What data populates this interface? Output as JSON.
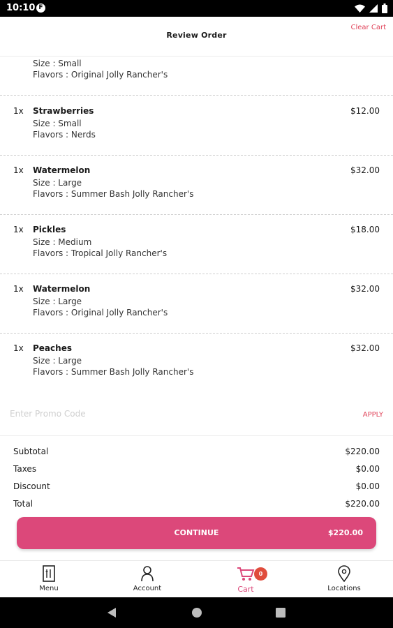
{
  "status_bar": {
    "time": "10:10",
    "app_icon": "F"
  },
  "header": {
    "title": "Review Order",
    "clear_cart_label": "Clear Cart"
  },
  "first_item_partial": {
    "size": "Size : Small",
    "flavors": "Flavors : Original Jolly Rancher's"
  },
  "items": [
    {
      "qty": "1x",
      "name": "Strawberries",
      "price": "$12.00",
      "size": "Size : Small",
      "flavors": "Flavors : Nerds"
    },
    {
      "qty": "1x",
      "name": "Watermelon",
      "price": "$32.00",
      "size": "Size : Large",
      "flavors": "Flavors : Summer Bash Jolly Rancher's"
    },
    {
      "qty": "1x",
      "name": "Pickles",
      "price": "$18.00",
      "size": "Size : Medium",
      "flavors": "Flavors : Tropical Jolly Rancher's"
    },
    {
      "qty": "1x",
      "name": "Watermelon",
      "price": "$32.00",
      "size": "Size : Large",
      "flavors": "Flavors : Original Jolly Rancher's"
    },
    {
      "qty": "1x",
      "name": "Peaches",
      "price": "$32.00",
      "size": "Size : Large",
      "flavors": "Flavors : Summer Bash Jolly Rancher's"
    }
  ],
  "promo": {
    "placeholder": "Enter Promo Code",
    "value": "",
    "apply_label": "APPLY"
  },
  "summary": {
    "subtotal_label": "Subtotal",
    "subtotal": "$220.00",
    "taxes_label": "Taxes",
    "taxes": "$0.00",
    "discount_label": "Discount",
    "discount": "$0.00",
    "total_label": "Total",
    "total": "$220.00"
  },
  "continue_button": {
    "label": "CONTINUE",
    "total": "$220.00"
  },
  "bottom_nav": {
    "items": [
      {
        "label": "Menu",
        "icon": "menu-icon"
      },
      {
        "label": "Account",
        "icon": "account-icon"
      },
      {
        "label": "Cart",
        "icon": "cart-icon",
        "badge": "0",
        "active": true
      },
      {
        "label": "Locations",
        "icon": "location-icon"
      }
    ]
  },
  "colors": {
    "accent": "#dc487a",
    "link": "#e0445a",
    "badge": "#e04c3c"
  }
}
